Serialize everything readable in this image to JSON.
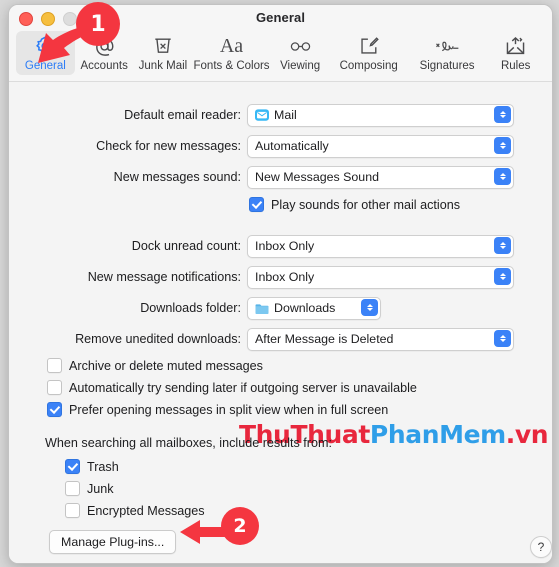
{
  "window": {
    "title": "General",
    "traffic_lights": [
      "close",
      "minimize",
      "zoom"
    ]
  },
  "toolbar": {
    "items": [
      {
        "label": "General",
        "icon": "gear-icon",
        "selected": true
      },
      {
        "label": "Accounts",
        "icon": "at-sign-icon",
        "selected": false
      },
      {
        "label": "Junk Mail",
        "icon": "junk-trash-icon",
        "selected": false
      },
      {
        "label": "Fonts & Colors",
        "icon": "aa-text-icon",
        "selected": false
      },
      {
        "label": "Viewing",
        "icon": "glasses-icon",
        "selected": false
      },
      {
        "label": "Composing",
        "icon": "compose-icon",
        "selected": false
      },
      {
        "label": "Signatures",
        "icon": "signature-icon",
        "selected": false
      },
      {
        "label": "Rules",
        "icon": "rules-envelope-icon",
        "selected": false
      }
    ]
  },
  "form": {
    "rows": [
      {
        "label": "Default email reader:",
        "value": "Mail",
        "icon": "mail-app-icon"
      },
      {
        "label": "Check for new messages:",
        "value": "Automatically",
        "icon": null
      },
      {
        "label": "New messages sound:",
        "value": "New Messages Sound",
        "icon": null
      },
      {
        "label": "Dock unread count:",
        "value": "Inbox Only",
        "icon": null
      },
      {
        "label": "New message notifications:",
        "value": "Inbox Only",
        "icon": null
      },
      {
        "label": "Downloads folder:",
        "value": "Downloads",
        "icon": "folder-icon"
      },
      {
        "label": "Remove unedited downloads:",
        "value": "After Message is Deleted",
        "icon": null
      }
    ],
    "play_sounds": {
      "label": "Play sounds for other mail actions",
      "checked": true
    },
    "options": [
      {
        "label": "Archive or delete muted messages",
        "checked": false
      },
      {
        "label": "Automatically try sending later if outgoing server is unavailable",
        "checked": false
      },
      {
        "label": "Prefer opening messages in split view when in full screen",
        "checked": true
      }
    ],
    "search_section": {
      "label": "When searching all mailboxes, include results from:",
      "options": [
        {
          "label": "Trash",
          "checked": true
        },
        {
          "label": "Junk",
          "checked": false
        },
        {
          "label": "Encrypted Messages",
          "checked": false
        }
      ]
    },
    "manage_plugins_label": "Manage Plug-ins...",
    "help_label": "?"
  },
  "annotations": [
    {
      "number": "1",
      "color": "#f43640"
    },
    {
      "number": "2",
      "color": "#f43640"
    }
  ],
  "watermark": {
    "part1": "ThuThuat",
    "part2": "PhanMem",
    "part3": ".vn",
    "color_red": "#e8273d",
    "color_blue": "#2f9ee8"
  }
}
